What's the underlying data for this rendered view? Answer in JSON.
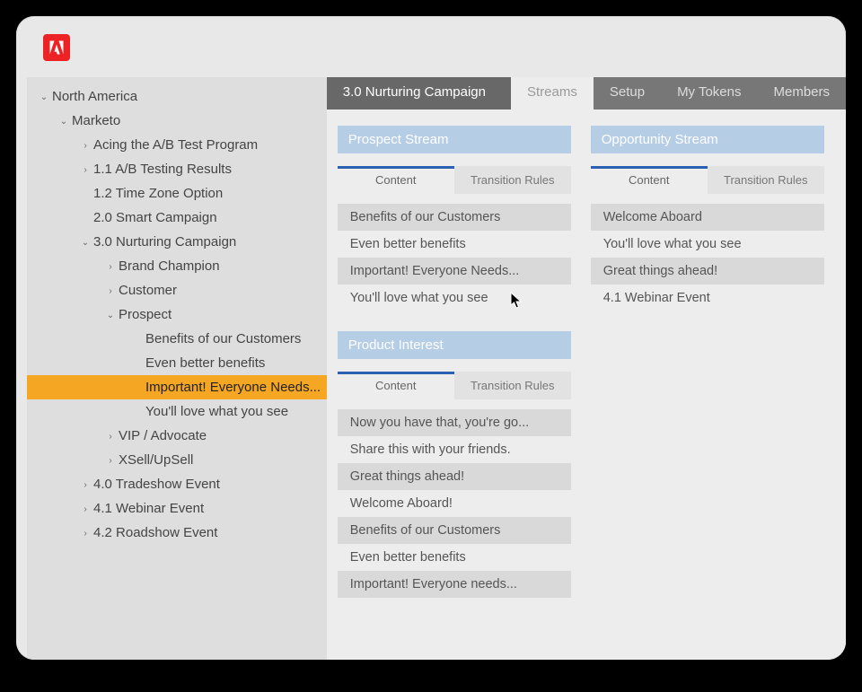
{
  "logo_name": "adobe-logo",
  "tabs": {
    "title": "3.0 Nurturing Campaign",
    "streams": "Streams",
    "setup": "Setup",
    "tokens": "My Tokens",
    "members": "Members"
  },
  "subtab_labels": {
    "content": "Content",
    "rules": "Transition Rules"
  },
  "tree": [
    {
      "label": "North America",
      "indent": 0,
      "chev": "down"
    },
    {
      "label": "Marketo",
      "indent": 1,
      "chev": "down"
    },
    {
      "label": "Acing the A/B Test Program",
      "indent": 2,
      "chev": "right"
    },
    {
      "label": "1.1 A/B Testing Results",
      "indent": 2,
      "chev": "right"
    },
    {
      "label": "1.2 Time Zone Option",
      "indent": 2,
      "chev": "none"
    },
    {
      "label": "2.0 Smart Campaign",
      "indent": 2,
      "chev": "none"
    },
    {
      "label": "3.0 Nurturing Campaign",
      "indent": 2,
      "chev": "down"
    },
    {
      "label": "Brand Champion",
      "indent": 3,
      "chev": "right"
    },
    {
      "label": "Customer",
      "indent": 3,
      "chev": "right"
    },
    {
      "label": "Prospect",
      "indent": 3,
      "chev": "down"
    },
    {
      "label": "Benefits of our Customers",
      "indent": 4,
      "chev": "none"
    },
    {
      "label": "Even better benefits",
      "indent": 4,
      "chev": "none"
    },
    {
      "label": "Important! Everyone Needs...",
      "indent": 4,
      "chev": "none",
      "selected": true
    },
    {
      "label": "You'll love what you see",
      "indent": 4,
      "chev": "none"
    },
    {
      "label": "VIP / Advocate",
      "indent": 3,
      "chev": "right"
    },
    {
      "label": "XSell/UpSell",
      "indent": 3,
      "chev": "right"
    },
    {
      "label": "4.0 Tradeshow Event",
      "indent": 2,
      "chev": "right"
    },
    {
      "label": "4.1 Webinar Event",
      "indent": 2,
      "chev": "right"
    },
    {
      "label": "4.2 Roadshow Event",
      "indent": 2,
      "chev": "right"
    }
  ],
  "streams": {
    "prospect": {
      "title": "Prospect Stream",
      "items": [
        {
          "label": "Benefits of our Customers",
          "shaded": true
        },
        {
          "label": "Even better benefits",
          "shaded": false
        },
        {
          "label": "Important! Everyone Needs...",
          "shaded": true
        },
        {
          "label": "You'll love what you see",
          "shaded": false
        }
      ]
    },
    "product": {
      "title": "Product Interest",
      "items": [
        {
          "label": "Now you have that, you're go...",
          "shaded": true
        },
        {
          "label": "Share this with your friends.",
          "shaded": false
        },
        {
          "label": "Great things ahead!",
          "shaded": true
        },
        {
          "label": "Welcome Aboard!",
          "shaded": false
        },
        {
          "label": "Benefits of our Customers",
          "shaded": true
        },
        {
          "label": "Even better benefits",
          "shaded": false
        },
        {
          "label": "Important! Everyone needs...",
          "shaded": true
        }
      ]
    },
    "opportunity": {
      "title": "Opportunity Stream",
      "items": [
        {
          "label": "Welcome Aboard",
          "shaded": true
        },
        {
          "label": "You'll love what you see",
          "shaded": false
        },
        {
          "label": "Great things ahead!",
          "shaded": true
        },
        {
          "label": "4.1 Webinar Event",
          "shaded": false
        }
      ]
    }
  }
}
